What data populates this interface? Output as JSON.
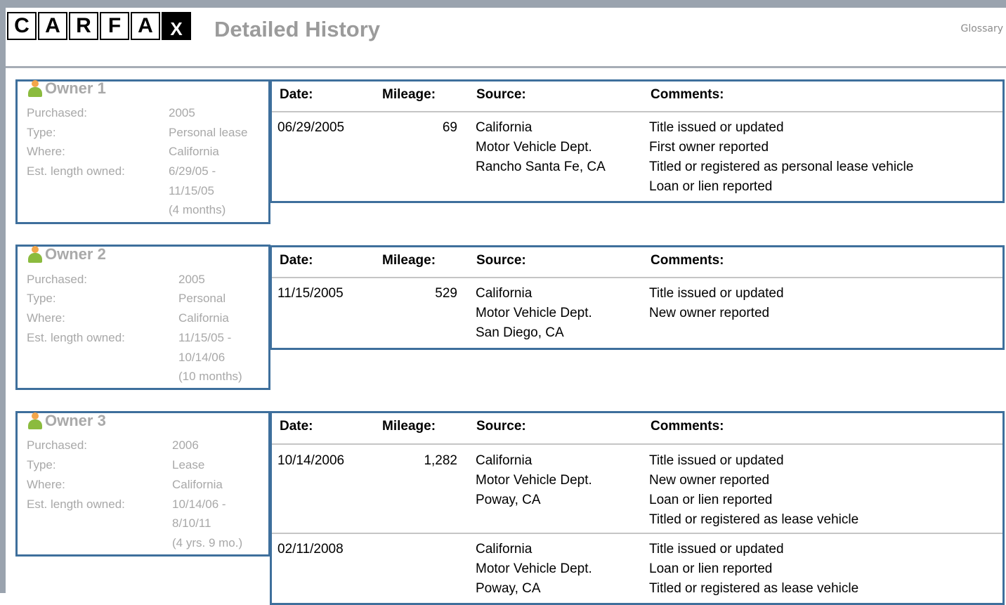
{
  "header": {
    "logo_letters": [
      "C",
      "A",
      "R",
      "F",
      "A",
      "X"
    ],
    "title": "Detailed History",
    "glossary_link": "Glossary"
  },
  "table_headers": {
    "date": "Date:",
    "mileage": "Mileage:",
    "source": "Source:",
    "comments": "Comments:"
  },
  "owners": [
    {
      "title": "Owner 1",
      "labels": {
        "purchased": "Purchased:",
        "type": "Type:",
        "where": "Where:",
        "length": "Est. length owned:"
      },
      "purchased": "2005",
      "type": "Personal lease",
      "where": "California",
      "length": [
        "6/29/05 -",
        "11/15/05",
        "(4 months)"
      ],
      "records": [
        {
          "date": "06/29/2005",
          "mileage": "69",
          "source": [
            "California",
            "Motor Vehicle Dept.",
            "Rancho Santa Fe, CA"
          ],
          "comments": [
            "Title issued or updated",
            "First owner reported",
            "Titled or registered as personal lease vehicle",
            "Loan or lien reported"
          ]
        }
      ]
    },
    {
      "title": "Owner 2",
      "labels": {
        "purchased": "Purchased:",
        "type": "Type:",
        "where": "Where:",
        "length": "Est. length owned:"
      },
      "purchased": "2005",
      "type": "Personal",
      "where": "California",
      "length": [
        "11/15/05 -",
        "10/14/06",
        "(10 months)"
      ],
      "records": [
        {
          "date": "11/15/2005",
          "mileage": "529",
          "source": [
            "California",
            "Motor Vehicle Dept.",
            "San Diego, CA"
          ],
          "comments": [
            "Title issued or updated",
            "New owner reported"
          ]
        }
      ]
    },
    {
      "title": "Owner 3",
      "labels": {
        "purchased": "Purchased:",
        "type": "Type:",
        "where": "Where:",
        "length": "Est. length owned:"
      },
      "purchased": "2006",
      "type": "Lease",
      "where": "California",
      "length": [
        "10/14/06 -",
        "8/10/11",
        "(4 yrs. 9 mo.)"
      ],
      "records": [
        {
          "date": "10/14/2006",
          "mileage": "1,282",
          "source": [
            "California",
            "Motor Vehicle Dept.",
            "Poway, CA"
          ],
          "comments": [
            "Title issued or updated",
            "New owner reported",
            "Loan or lien reported",
            "Titled or registered as lease vehicle"
          ]
        },
        {
          "date": "02/11/2008",
          "mileage": "",
          "source": [
            "California",
            "Motor Vehicle Dept.",
            "Poway, CA"
          ],
          "comments": [
            "Title issued or updated",
            "Loan or lien reported",
            "Titled or registered as lease vehicle"
          ]
        }
      ]
    }
  ],
  "colors": {
    "border_blue": "#3e6f9c",
    "muted_text": "#a8a8a8",
    "page_frame": "#9aa3ae"
  }
}
